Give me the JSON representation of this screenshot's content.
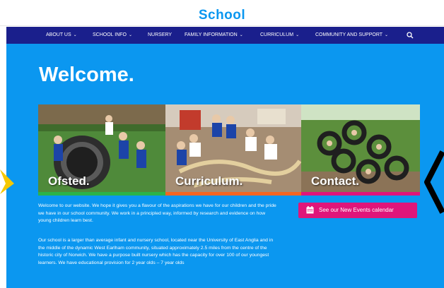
{
  "header": {
    "logo_text": "School"
  },
  "nav": {
    "items": [
      {
        "label": "ABOUT US",
        "dropdown": true
      },
      {
        "label": "SCHOOL INFO",
        "dropdown": true
      },
      {
        "label": "NURSERY",
        "dropdown": false
      },
      {
        "label": "FAMILY INFORMATION",
        "dropdown": true
      },
      {
        "label": "CURRICULUM",
        "dropdown": true
      },
      {
        "label": "COMMUNITY AND SUPPORT",
        "dropdown": true
      }
    ],
    "search_icon": "search-icon"
  },
  "main": {
    "heading": "Welcome.",
    "tiles": [
      {
        "label": "Ofsted.",
        "bar_color": "#2bb34a"
      },
      {
        "label": "Curriculum.",
        "bar_color": "#f26522"
      },
      {
        "label": "Contact.",
        "bar_color": "#e0157a"
      }
    ],
    "paragraphs": [
      "Welcome to our website.  We hope it gives you a flavour of the aspirations we have for our children and the pride we have in our school community. We work in a principled way, informed by research and evidence on how young children learn best.",
      "Our school is a larger than average infant and nursery school, located near the University of East Anglia and in the middle of the dynamic West Earlham community, situated approximately 2.5 miles from the centre of the historic city of Norwich. We have a purpose built nursery which has the capacity for over 100 of our youngest learners. We have educational provision for 2 year olds – 7 year olds"
    ],
    "events_button": {
      "label": "See our New Events calendar",
      "icon": "calendar-icon"
    }
  },
  "colors": {
    "nav_bg": "#1a1f8c",
    "main_bg": "#0b97f0",
    "button_bg": "#e0157a",
    "star": "#f5c800"
  }
}
